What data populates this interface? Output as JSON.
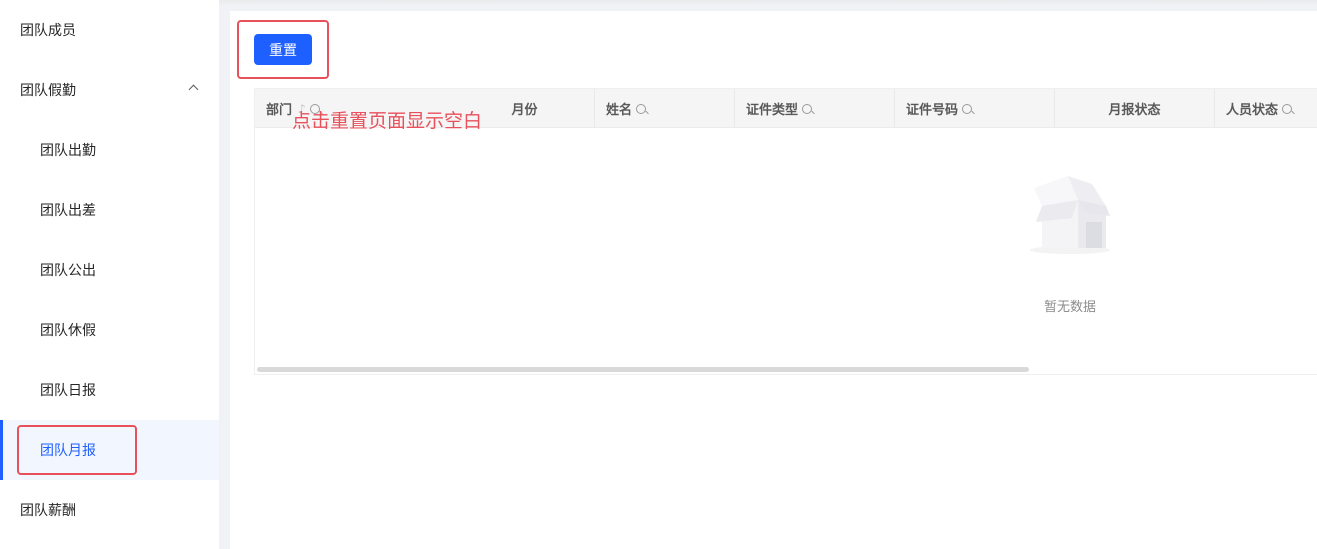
{
  "sidebar": {
    "items": [
      {
        "label": "团队成员"
      },
      {
        "label": "团队假勤"
      },
      {
        "label": "团队出勤"
      },
      {
        "label": "团队出差"
      },
      {
        "label": "团队公出"
      },
      {
        "label": "团队休假"
      },
      {
        "label": "团队日报"
      },
      {
        "label": "团队月报"
      },
      {
        "label": "团队薪酬"
      }
    ]
  },
  "toolbar": {
    "reset_label": "重置"
  },
  "annotation": {
    "text": "点击重置页面显示空白"
  },
  "table": {
    "columns": [
      {
        "label": "部门"
      },
      {
        "label": "月份"
      },
      {
        "label": "姓名"
      },
      {
        "label": "证件类型"
      },
      {
        "label": "证件号码"
      },
      {
        "label": "月报状态"
      },
      {
        "label": "人员状态"
      }
    ],
    "empty_text": "暂无数据"
  },
  "colors": {
    "accent": "#1e5fff",
    "annotation": "#e8505b"
  }
}
